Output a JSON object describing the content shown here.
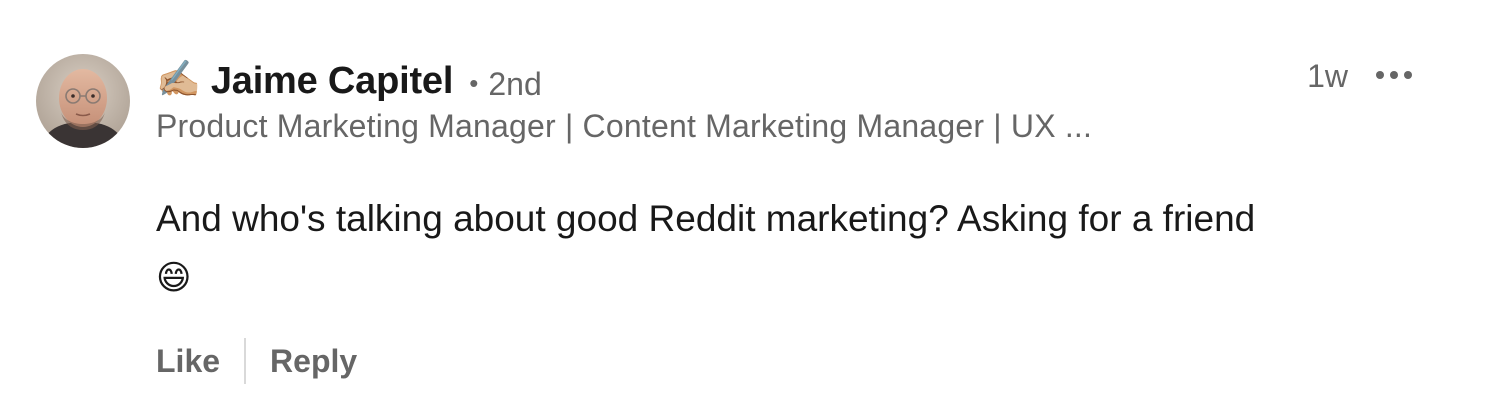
{
  "comment": {
    "author": {
      "name": "Jaime Capitel",
      "prefix_emoji": "✍🏼",
      "connection_degree": "2nd",
      "separator": "•",
      "headline": "Product Marketing Manager | Content Marketing Manager | UX ..."
    },
    "timestamp": "1w",
    "more_icon": "ellipsis-horizontal-icon",
    "text": "And who's talking about good Reddit marketing? Asking for a friend",
    "text_emoji": "😄",
    "actions": {
      "like_label": "Like",
      "reply_label": "Reply"
    }
  },
  "colors": {
    "primary_text": "#191919",
    "secondary_text": "#666666",
    "divider": "#d9d9d9",
    "background": "#ffffff"
  }
}
